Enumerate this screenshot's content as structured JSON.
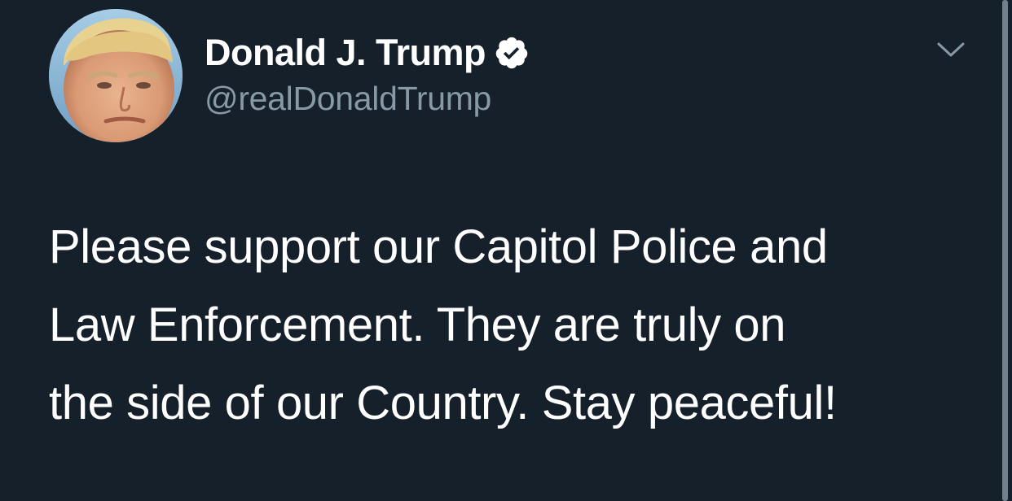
{
  "tweet": {
    "author": {
      "name": "Donald J. Trump",
      "handle": "@realDonaldTrump",
      "verified": true
    },
    "text_lines": [
      "Please support our Capitol Police and",
      "Law Enforcement. They are truly on",
      "the side of our Country. Stay peaceful!"
    ],
    "menu_icon": "chevron-down-icon"
  },
  "colors": {
    "background": "#15202b",
    "text_primary": "#ffffff",
    "text_secondary": "#8899a6"
  }
}
